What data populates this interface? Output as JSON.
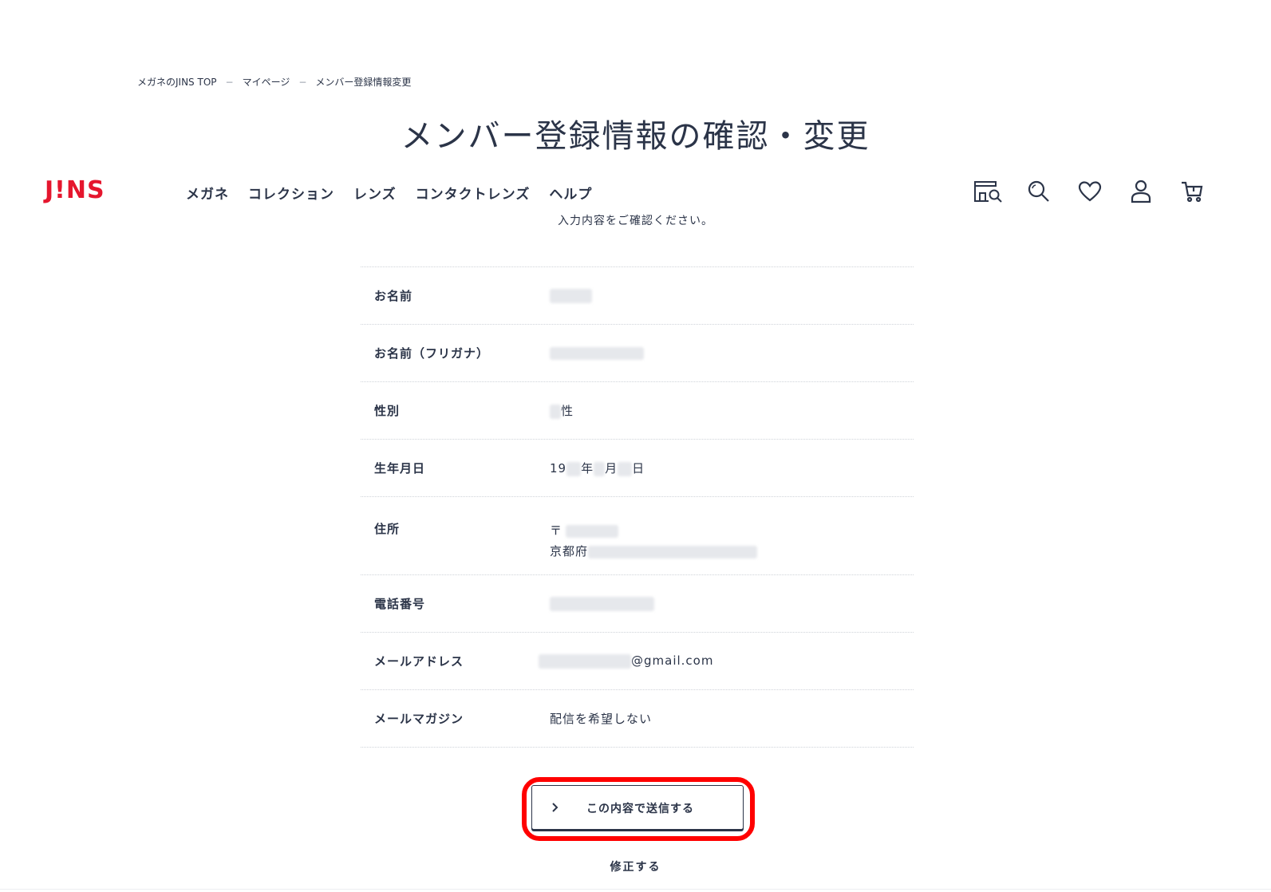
{
  "breadcrumb": {
    "items": [
      "メガネのJINS TOP",
      "マイページ",
      "メンバー登録情報変更"
    ],
    "separator": "−"
  },
  "page_title": "メンバー登録情報の確認・変更",
  "header": {
    "logo": "J!NS",
    "nav": [
      "メガネ",
      "コレクション",
      "レンズ",
      "コンタクトレンズ",
      "ヘルプ"
    ],
    "icons": [
      "store-search-icon",
      "search-icon",
      "heart-icon",
      "user-icon",
      "cart-icon"
    ]
  },
  "lead": "入力内容をご確認ください。",
  "fields": {
    "name": {
      "label": "お名前"
    },
    "kana": {
      "label": "お名前（フリガナ）"
    },
    "gender": {
      "label": "性別",
      "suffix": "性"
    },
    "birthday": {
      "label": "生年月日",
      "prefix": "19",
      "year": "年",
      "month": "月",
      "day": "日"
    },
    "address": {
      "label": "住所",
      "postal_mark": "〒",
      "prefecture": "京都府"
    },
    "phone": {
      "label": "電話番号"
    },
    "email": {
      "label": "メールアドレス",
      "domain": "@gmail.com"
    },
    "magazine": {
      "label": "メールマガジン",
      "value": "配信を希望しない"
    }
  },
  "actions": {
    "submit": "この内容で送信する",
    "modify": "修正する"
  },
  "colors": {
    "brand": "#e5162e",
    "text": "#2b3448",
    "highlight": "#ff0000"
  }
}
